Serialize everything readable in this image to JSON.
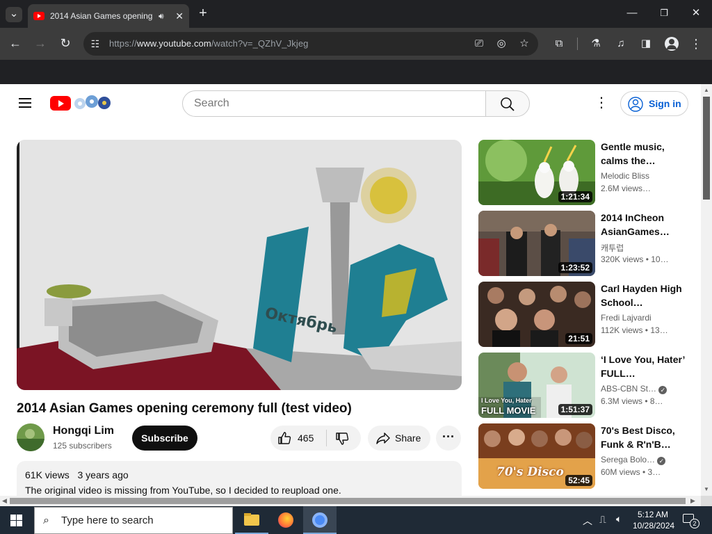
{
  "browser": {
    "tab_title": "2014 Asian Games opening",
    "url_prefix": "https://",
    "url_host": "www.youtube.com",
    "url_path": "/watch?v=_QZhV_Jkjeg"
  },
  "youtube": {
    "search_placeholder": "Search",
    "sign_in_label": "Sign in",
    "video_title": "2014 Asian Games opening ceremony full (test video)",
    "channel_name": "Hongqi Lim",
    "subscribers": "125 subscribers",
    "subscribe_label": "Subscribe",
    "like_count": "465",
    "share_label": "Share",
    "views": "61K views",
    "age": "3 years ago",
    "description": "The original video is missing from YouTube, so I decided to reupload one.",
    "player_caption": "Октябрь"
  },
  "related": [
    {
      "title": "Gentle music, calms the…",
      "channel": "Melodic Bliss",
      "views": "2.6M views…",
      "duration": "1:21:34",
      "verified": false
    },
    {
      "title": "2014 InCheon AsianGames…",
      "channel": "캐투럽",
      "views": "320K views  • 10…",
      "duration": "1:23:52",
      "verified": false
    },
    {
      "title": "Carl Hayden High School…",
      "channel": "Fredi Lajvardi",
      "views": "112K views  • 13…",
      "duration": "21:51",
      "verified": false
    },
    {
      "title": "‘I Love You, Hater’ FULL…",
      "channel": "ABS-CBN St…",
      "views": "6.3M views  • 8…",
      "duration": "1:51:37",
      "verified": true,
      "thumb_text": "I Love You, Hater",
      "thumb_text2": "FULL MOVIE"
    },
    {
      "title": "70's Best Disco, Funk & R'n'B…",
      "channel": "Serega Bolo…",
      "views": "60M views  • 3…",
      "duration": "52:45",
      "verified": true,
      "thumb_text": "70's Disco"
    }
  ],
  "taskbar": {
    "search_placeholder": "Type here to search",
    "time": "5:12 AM",
    "date": "10/28/2024",
    "notification_count": "2"
  },
  "colors": {
    "brand_red": "#ff0000",
    "link_blue": "#065fd4",
    "chrome_dark": "#202124"
  }
}
